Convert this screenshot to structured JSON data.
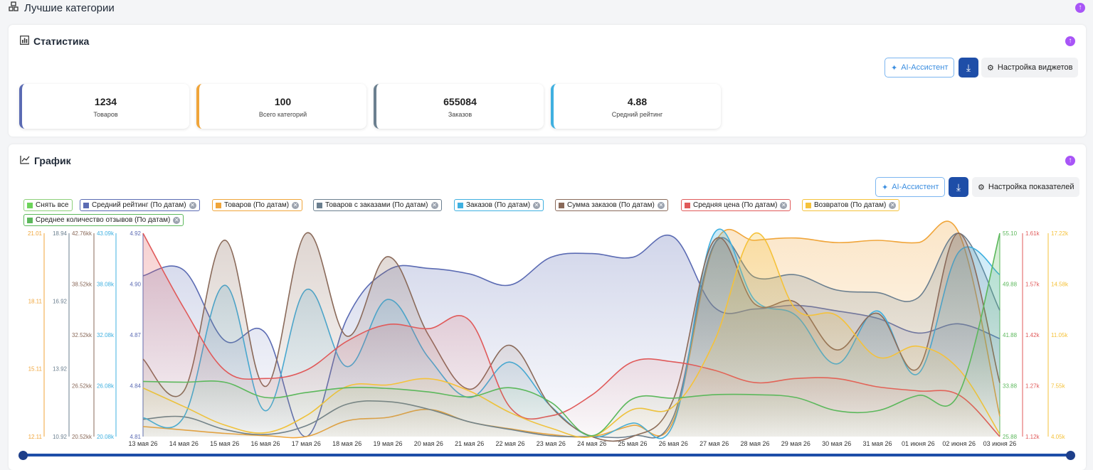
{
  "section": {
    "title": "Лучшие категории"
  },
  "stats": {
    "title": "Статистика",
    "ai_label": "AI-Ассистент",
    "settings_label": "Настройка виджетов",
    "kpis": [
      {
        "value": "1234",
        "label": "Товаров",
        "color": "#5b6bb3"
      },
      {
        "value": "100",
        "label": "Всего категорий",
        "color": "#f0a53a"
      },
      {
        "value": "655084",
        "label": "Заказов",
        "color": "#6b7f8f"
      },
      {
        "value": "4.88",
        "label": "Средний рейтинг",
        "color": "#3fb0e0"
      }
    ]
  },
  "graph": {
    "title": "График",
    "ai_label": "AI-Ассистент",
    "settings_label": "Настройка показателей",
    "clear_label": "Снять все",
    "legend": [
      {
        "label": "Средний рейтинг (По датам)",
        "color": "#5b6bb3"
      },
      {
        "label": "Товаров (По датам)",
        "color": "#f0a53a"
      },
      {
        "label": "Товаров с заказами (По датам)",
        "color": "#6b7f8f"
      },
      {
        "label": "Заказов (По датам)",
        "color": "#3fb0e0"
      },
      {
        "label": "Сумма заказов (По датам)",
        "color": "#8a6a5a"
      },
      {
        "label": "Средняя цена (По датам)",
        "color": "#e05a5a"
      },
      {
        "label": "Возвратов (По датам)",
        "color": "#f5c23a"
      },
      {
        "label": "Среднее количество отзывов (По датам)",
        "color": "#5cb85c"
      }
    ]
  },
  "chart_data": {
    "type": "area",
    "categories": [
      "13 мая 26",
      "14 мая 26",
      "15 мая 26",
      "16 мая 26",
      "17 мая 26",
      "18 мая 26",
      "19 мая 26",
      "20 мая 26",
      "21 мая 26",
      "22 мая 26",
      "23 мая 26",
      "24 мая 26",
      "25 мая 26",
      "26 мая 26",
      "27 мая 26",
      "28 мая 26",
      "29 мая 26",
      "30 мая 26",
      "31 мая 26",
      "01 июня 26",
      "02 июня 26",
      "03 июня 26"
    ],
    "axes": {
      "left": [
        {
          "color": "#f0a53a",
          "ticks": [
            "21.01",
            "18.11",
            "15.11",
            "12.11"
          ]
        },
        {
          "color": "#6b7f8f",
          "ticks": [
            "18.94",
            "16.92",
            "13.92",
            "10.92"
          ]
        },
        {
          "color": "#8a6a5a",
          "ticks": [
            "42.76kk",
            "38.52kk",
            "32.52kk",
            "26.52kk",
            "20.52kk"
          ]
        },
        {
          "color": "#3fb0e0",
          "ticks": [
            "43.09k",
            "38.08k",
            "32.08k",
            "26.08k",
            "20.08k"
          ]
        },
        {
          "color": "#5b6bb3",
          "ticks": [
            "4.92",
            "4.90",
            "4.87",
            "4.84",
            "4.81"
          ]
        }
      ],
      "right": [
        {
          "color": "#5cb85c",
          "ticks": [
            "55.10",
            "49.88",
            "41.88",
            "33.88",
            "25.88"
          ]
        },
        {
          "color": "#e05a5a",
          "ticks": [
            "1.61k",
            "1.57k",
            "1.42k",
            "1.27k",
            "1.12k"
          ]
        },
        {
          "color": "#f5c23a",
          "ticks": [
            "17.22k",
            "14.58k",
            "11.05k",
            "7.55k",
            "4.05k"
          ]
        }
      ]
    },
    "series": [
      {
        "name": "Средний рейтинг (По датам)",
        "color": "#5b6bb3",
        "values": [
          4.897,
          4.9,
          4.862,
          4.866,
          4.81,
          4.874,
          4.9,
          4.901,
          4.898,
          4.892,
          4.907,
          4.909,
          4.907,
          4.918,
          4.88,
          4.879,
          4.881,
          4.878,
          4.874,
          4.866,
          4.871,
          4.863
        ]
      },
      {
        "name": "Товаров (По датам)",
        "color": "#f0a53a",
        "values": [
          12.55,
          12.4,
          12.25,
          12.15,
          12.11,
          12.8,
          12.95,
          13.3,
          12.75,
          12.45,
          12.2,
          12.11,
          12.6,
          12.8,
          20.5,
          20.7,
          20.8,
          20.6,
          20.7,
          20.6,
          21.01,
          13.0
        ]
      },
      {
        "name": "Товаров с заказами (По датам)",
        "color": "#6b7f8f",
        "values": [
          11.6,
          11.7,
          11.2,
          11.0,
          11.35,
          12.2,
          12.3,
          12.0,
          11.5,
          11.2,
          10.95,
          10.92,
          10.95,
          11.7,
          18.5,
          17.2,
          17.3,
          16.7,
          16.6,
          16.4,
          18.94,
          15.9
        ]
      },
      {
        "name": "Заказов (По датам)",
        "color": "#3fb0e0",
        "values": [
          22.2,
          22.3,
          37.2,
          23.0,
          36.7,
          28.0,
          35.6,
          29.0,
          24.5,
          28.5,
          23.5,
          20.08,
          21.6,
          21.5,
          43.09,
          35.5,
          33.8,
          28.3,
          34.3,
          27.2,
          41.0,
          38.4
        ]
      },
      {
        "name": "Сумма заказов (По датам)",
        "color": "#8a6a5a",
        "values": [
          29.0,
          25.5,
          42.0,
          26.0,
          42.76,
          31.5,
          40.2,
          31.6,
          25.7,
          30.5,
          23.8,
          20.52,
          20.52,
          24.6,
          42.0,
          35.0,
          35.2,
          30.0,
          34.0,
          28.0,
          42.76,
          26.4
        ]
      },
      {
        "name": "Средняя цена (По датам)",
        "color": "#e05a5a",
        "values": [
          1.61,
          1.43,
          1.28,
          1.26,
          1.28,
          1.35,
          1.39,
          1.38,
          1.4,
          1.19,
          1.17,
          1.22,
          1.3,
          1.3,
          1.28,
          1.25,
          1.26,
          1.26,
          1.24,
          1.23,
          1.22,
          1.12
        ]
      },
      {
        "name": "Возвратов (По датам)",
        "color": "#f5c23a",
        "values": [
          7.2,
          6.0,
          4.8,
          4.3,
          5.4,
          7.3,
          7.4,
          7.8,
          7.0,
          5.6,
          4.6,
          4.05,
          5.8,
          6.0,
          10.2,
          17.22,
          12.3,
          11.9,
          9.2,
          9.9,
          8.4,
          4.2
        ]
      },
      {
        "name": "Среднее количество отзывов (По датам)",
        "color": "#5cb85c",
        "values": [
          33.8,
          33.7,
          33.7,
          31.5,
          32.2,
          32.9,
          32.8,
          32.3,
          31.6,
          32.9,
          30.8,
          26.0,
          31.3,
          31.4,
          31.9,
          31.9,
          31.5,
          29.6,
          29.6,
          31.8,
          32.1,
          55.1
        ]
      }
    ]
  }
}
